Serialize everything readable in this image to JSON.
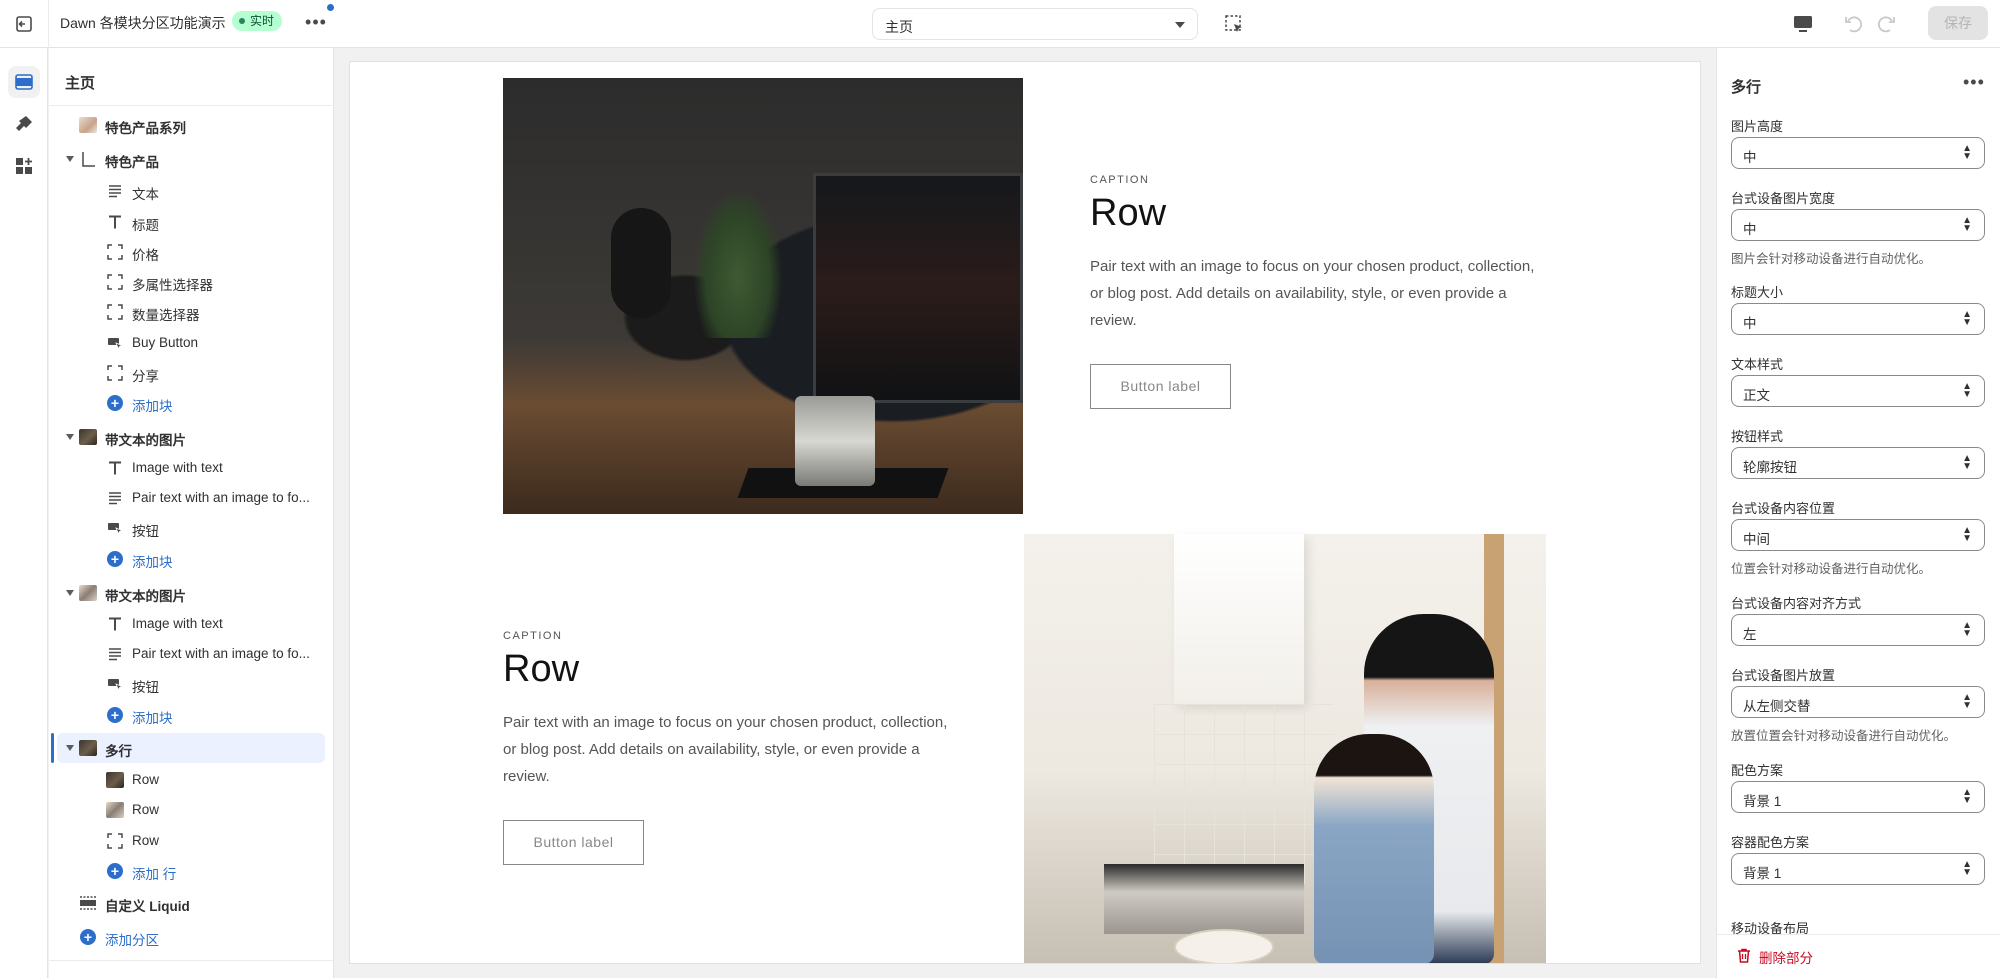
{
  "topbar": {
    "theme_name": "Dawn 各模块分区功能演示",
    "status_badge": "实时",
    "template_select": "主页",
    "save_label": "保存"
  },
  "sidebar": {
    "title": "主页",
    "items": [
      {
        "label": "特色产品系列"
      },
      {
        "label": "特色产品"
      },
      {
        "label": "文本"
      },
      {
        "label": "标题"
      },
      {
        "label": "价格"
      },
      {
        "label": "多属性选择器"
      },
      {
        "label": "数量选择器"
      },
      {
        "label": "Buy Button"
      },
      {
        "label": "分享"
      },
      {
        "label": "添加块"
      },
      {
        "label": "带文本的图片"
      },
      {
        "label": "Image with text"
      },
      {
        "label": "Pair text with an image to fo..."
      },
      {
        "label": "按钮"
      },
      {
        "label": "添加块"
      },
      {
        "label": "带文本的图片"
      },
      {
        "label": "Image with text"
      },
      {
        "label": "Pair text with an image to fo..."
      },
      {
        "label": "按钮"
      },
      {
        "label": "添加块"
      },
      {
        "label": "多行"
      },
      {
        "label": "Row"
      },
      {
        "label": "Row"
      },
      {
        "label": "Row"
      },
      {
        "label": "添加 行"
      },
      {
        "label": "自定义 Liquid"
      },
      {
        "label": "添加分区"
      }
    ]
  },
  "canvas": {
    "rows": [
      {
        "caption": "CAPTION",
        "heading": "Row",
        "body": "Pair text with an image to focus on your chosen product, collection, or blog post. Add details on availability, style, or even provide a review.",
        "button": "Button label"
      },
      {
        "caption": "CAPTION",
        "heading": "Row",
        "body": "Pair text with an image to focus on your chosen product, collection, or blog post. Add details on availability, style, or even provide a review.",
        "button": "Button label"
      }
    ]
  },
  "panel": {
    "title": "多行",
    "fields": [
      {
        "label": "图片高度",
        "value": "中"
      },
      {
        "label": "台式设备图片宽度",
        "value": "中",
        "help": "图片会针对移动设备进行自动优化。"
      },
      {
        "label": "标题大小",
        "value": "中"
      },
      {
        "label": "文本样式",
        "value": "正文"
      },
      {
        "label": "按钮样式",
        "value": "轮廓按钮"
      },
      {
        "label": "台式设备内容位置",
        "value": "中间",
        "help": "位置会针对移动设备进行自动优化。"
      },
      {
        "label": "台式设备内容对齐方式",
        "value": "左"
      },
      {
        "label": "台式设备图片放置",
        "value": "从左侧交替",
        "help": "放置位置会针对移动设备进行自动优化。"
      },
      {
        "label": "配色方案",
        "value": "背景 1"
      },
      {
        "label": "容器配色方案",
        "value": "背景 1"
      }
    ],
    "cut_label": "移动设备布局",
    "delete_label": "删除部分"
  },
  "colors": {
    "accent": "#2c6ecb",
    "badge_bg": "#b4fed2",
    "danger": "#c70a24"
  }
}
